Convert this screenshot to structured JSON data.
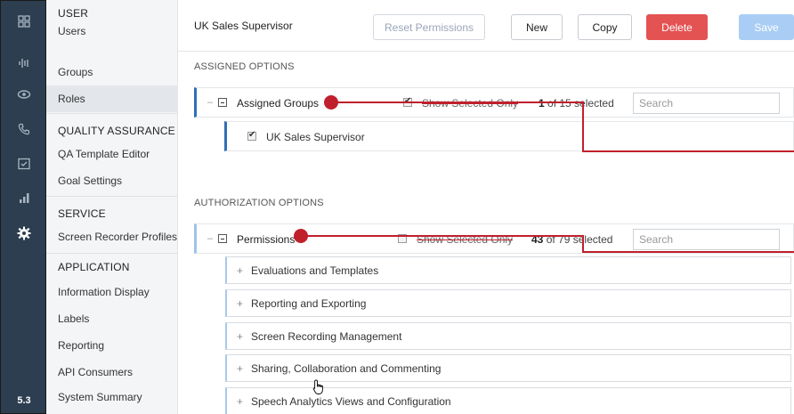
{
  "rail": {
    "items": [
      {
        "icon": "dashboard-grid-icon"
      },
      {
        "icon": "audio-wave-icon"
      },
      {
        "icon": "eye-icon"
      },
      {
        "icon": "phone-icon"
      },
      {
        "icon": "checklist-icon"
      },
      {
        "icon": "bar-chart-icon"
      },
      {
        "icon": "gear-icon"
      }
    ],
    "version": "5.3"
  },
  "nav": {
    "groups": [
      {
        "heading": "USER",
        "items": [
          "Users",
          "Groups",
          "Roles"
        ]
      },
      {
        "heading": "QUALITY ASSURANCE",
        "items": [
          "QA Template Editor",
          "Goal Settings"
        ]
      },
      {
        "heading": "SERVICE",
        "items": [
          "Screen Recorder Profiles"
        ]
      },
      {
        "heading": "APPLICATION",
        "items": [
          "Information Display",
          "Labels",
          "Reporting",
          "API Consumers",
          "System Summary"
        ]
      }
    ],
    "active_item": "Roles"
  },
  "header": {
    "role_name": "UK Sales Supervisor",
    "reset_label": "Reset Permissions",
    "new_label": "New",
    "copy_label": "Copy",
    "delete_label": "Delete",
    "save_label": "Save"
  },
  "assigned": {
    "section_title": "ASSIGNED OPTIONS",
    "panel_title": "Assigned Groups",
    "collapse_dash": "–",
    "show_selected_label": "Show Selected Only",
    "show_selected_checked": true,
    "count_selected": "1",
    "count_rest": "of 15 selected",
    "search_placeholder": "Search",
    "groups": [
      {
        "label": "UK Sales Supervisor",
        "checked": true
      }
    ]
  },
  "authorization": {
    "section_title": "AUTHORIZATION OPTIONS",
    "panel_title": "Permissions",
    "collapse_dash": "–",
    "show_selected_label": "Show Selected Only",
    "show_selected_checked": false,
    "count_selected": "43",
    "count_rest": "of 79 selected",
    "search_placeholder": "Search",
    "plus_glyph": "+",
    "categories": [
      "Evaluations and Templates",
      "Reporting and Exporting",
      "Screen Recording Management",
      "Sharing, Collaboration and Commenting",
      "Speech Analytics Views and Configuration"
    ]
  },
  "colors": {
    "rail_bg": "#2c3e50",
    "accent_blue": "#2f6fb5",
    "delete_red": "#e35352",
    "save_disabled": "#a9cdf5",
    "annotation_red": "#c0202c"
  }
}
